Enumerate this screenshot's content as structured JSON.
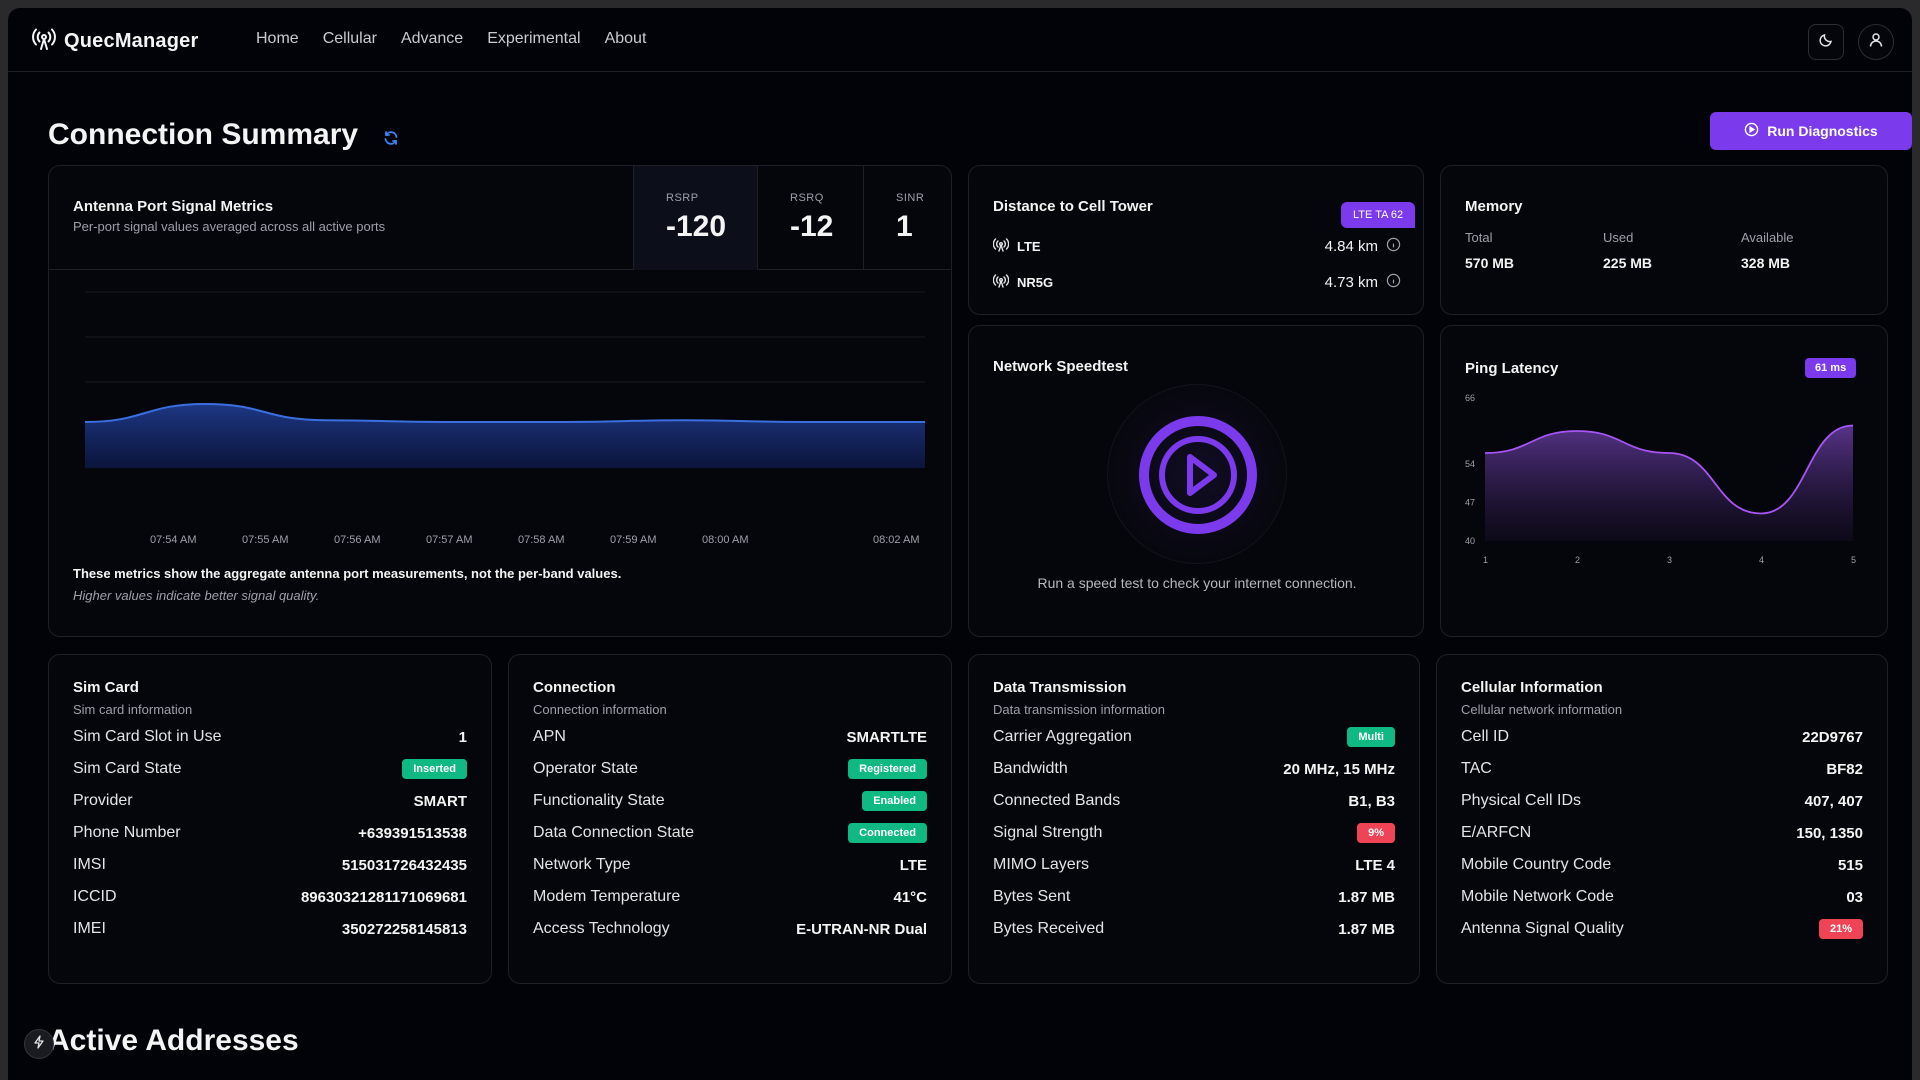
{
  "app": {
    "name": "QuecManager",
    "nav": [
      "Home",
      "Cellular",
      "Advance",
      "Experimental",
      "About"
    ]
  },
  "page": {
    "title": "Connection Summary",
    "run_button": "Run Diagnostics"
  },
  "antenna": {
    "title": "Antenna Port Signal Metrics",
    "subtitle": "Per-port signal values averaged across all active ports",
    "metrics": [
      {
        "label": "RSRP",
        "value": "-120"
      },
      {
        "label": "RSRQ",
        "value": "-12"
      },
      {
        "label": "SINR",
        "value": "1"
      }
    ],
    "time_ticks": [
      "07:54 AM",
      "07:55 AM",
      "07:56 AM",
      "07:57 AM",
      "07:58 AM",
      "07:59 AM",
      "08:00 AM",
      "08:02 AM"
    ],
    "note": "These metrics show the aggregate antenna port measurements, not the per-band values.",
    "note2": "Higher values indicate better signal quality."
  },
  "distance": {
    "title": "Distance to Cell Tower",
    "badge": "LTE TA 62",
    "rows": [
      {
        "label": "LTE",
        "value": "4.84 km"
      },
      {
        "label": "NR5G",
        "value": "4.73 km"
      }
    ]
  },
  "memory": {
    "title": "Memory",
    "cols": [
      {
        "label": "Total",
        "value": "570 MB"
      },
      {
        "label": "Used",
        "value": "225 MB"
      },
      {
        "label": "Available",
        "value": "328 MB"
      }
    ]
  },
  "speedtest": {
    "title": "Network Speedtest",
    "caption": "Run a speed test to check your internet connection."
  },
  "ping": {
    "title": "Ping Latency",
    "badge": "61 ms",
    "y_ticks": [
      "66",
      "54",
      "47",
      "40"
    ],
    "x_ticks": [
      "1",
      "2",
      "3",
      "4",
      "5"
    ]
  },
  "chart_data": [
    {
      "type": "area",
      "x": [
        "07:54 AM",
        "07:55 AM",
        "07:56 AM",
        "07:57 AM",
        "07:58 AM",
        "07:59 AM",
        "08:00 AM",
        "08:02 AM"
      ],
      "series": [
        {
          "values": [
            0,
            10,
            1,
            0,
            0,
            1,
            0,
            0
          ]
        }
      ],
      "note": "relative waveform only; no y-axis labels shown"
    },
    {
      "type": "area",
      "title": "Ping Latency",
      "x": [
        1,
        2,
        3,
        4,
        5
      ],
      "series": [
        {
          "values": [
            56,
            60,
            56,
            45,
            61
          ]
        }
      ],
      "ylim": [
        40,
        66
      ],
      "y_ticks": [
        66,
        54,
        47,
        40
      ]
    }
  ],
  "sim": {
    "title": "Sim Card",
    "subtitle": "Sim card information",
    "rows": [
      {
        "k": "Sim Card Slot in Use",
        "v": "1"
      },
      {
        "k": "Sim Card State",
        "v": "Inserted",
        "badge": "green"
      },
      {
        "k": "Provider",
        "v": "SMART"
      },
      {
        "k": "Phone Number",
        "v": "+639391513538"
      },
      {
        "k": "IMSI",
        "v": "515031726432435"
      },
      {
        "k": "ICCID",
        "v": "8963032128117106968​1"
      },
      {
        "k": "IMEI",
        "v": "350272258145813"
      }
    ]
  },
  "connection": {
    "title": "Connection",
    "subtitle": "Connection information",
    "rows": [
      {
        "k": "APN",
        "v": "SMARTLTE"
      },
      {
        "k": "Operator State",
        "v": "Registered",
        "badge": "green"
      },
      {
        "k": "Functionality State",
        "v": "Enabled",
        "badge": "green"
      },
      {
        "k": "Data Connection State",
        "v": "Connected",
        "badge": "green"
      },
      {
        "k": "Network Type",
        "v": "LTE"
      },
      {
        "k": "Modem Temperature",
        "v": "41°C"
      },
      {
        "k": "Access Technology",
        "v": "E-UTRAN-NR Dual"
      }
    ]
  },
  "data_tx": {
    "title": "Data Transmission",
    "subtitle": "Data transmission information",
    "rows": [
      {
        "k": "Carrier Aggregation",
        "v": "Multi",
        "badge": "green"
      },
      {
        "k": "Bandwidth",
        "v": "20 MHz, 15 MHz"
      },
      {
        "k": "Connected Bands",
        "v": "B1, B3"
      },
      {
        "k": "Signal Strength",
        "v": "9%",
        "badge": "red"
      },
      {
        "k": "MIMO Layers",
        "v": "LTE 4"
      },
      {
        "k": "Bytes Sent",
        "v": "1.87 MB"
      },
      {
        "k": "Bytes Received",
        "v": "1.87 MB"
      }
    ]
  },
  "cellular": {
    "title": "Cellular Information",
    "subtitle": "Cellular network information",
    "rows": [
      {
        "k": "Cell ID",
        "v": "22D9767"
      },
      {
        "k": "TAC",
        "v": "BF82"
      },
      {
        "k": "Physical Cell IDs",
        "v": "407, 407"
      },
      {
        "k": "E/ARFCN",
        "v": "150, 1350"
      },
      {
        "k": "Mobile Country Code",
        "v": "515"
      },
      {
        "k": "Mobile Network Code",
        "v": "03"
      },
      {
        "k": "Antenna Signal Quality",
        "v": "21%",
        "badge": "red"
      }
    ]
  },
  "section2": {
    "title": "Active Addresses"
  }
}
